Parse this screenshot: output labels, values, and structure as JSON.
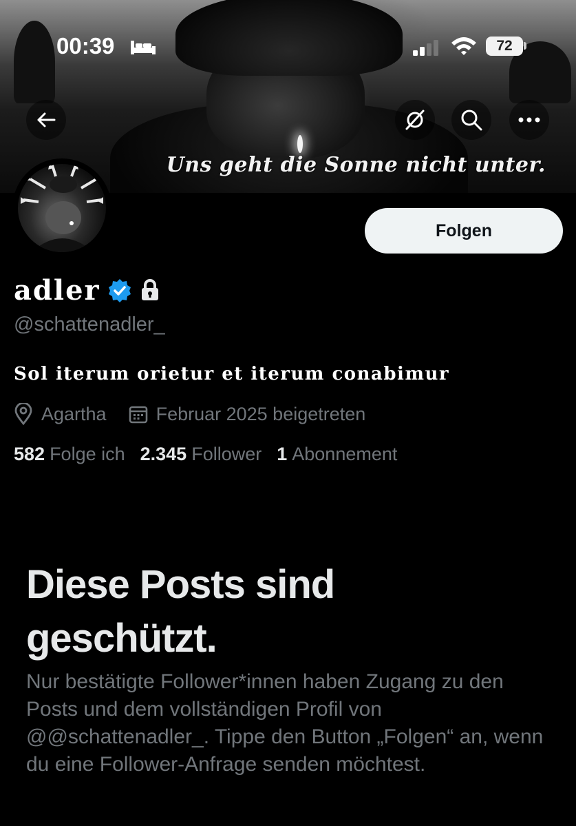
{
  "status_bar": {
    "time": "00:39",
    "battery": "72",
    "icons": [
      "bed-icon",
      "cellular-signal-icon",
      "wifi-icon",
      "battery-icon"
    ]
  },
  "top_nav": {
    "icons": [
      "back-arrow-icon",
      "grok-icon",
      "search-icon",
      "more-icon"
    ]
  },
  "banner": {
    "caption": "Uns geht die Sonne nicht unter."
  },
  "profile": {
    "display_name": "adler",
    "handle": "@schattenadler_",
    "bio": "Sol iterum orietur et iterum conabimur",
    "location": "Agartha",
    "joined": "Februar 2025 beigetreten",
    "follow_button": "Folgen",
    "stats": [
      {
        "value": "582",
        "label": "Folge ich"
      },
      {
        "value": "2.345",
        "label": "Follower"
      },
      {
        "value": "1",
        "label": "Abonnement"
      }
    ]
  },
  "protected": {
    "title": "Diese Posts sind geschützt.",
    "text": "Nur bestätigte Follower*innen haben Zugang zu den Posts und dem vollständigen Profil von @@schattenadler_. Tippe den Button „Folgen“ an, wenn du eine Follower-Anfrage senden möchtest."
  },
  "colors": {
    "background": "#000000",
    "text_primary": "#e7e9ea",
    "text_secondary": "#71767b",
    "verified": "#1d9bf0",
    "button_bg": "#eff3f4"
  }
}
